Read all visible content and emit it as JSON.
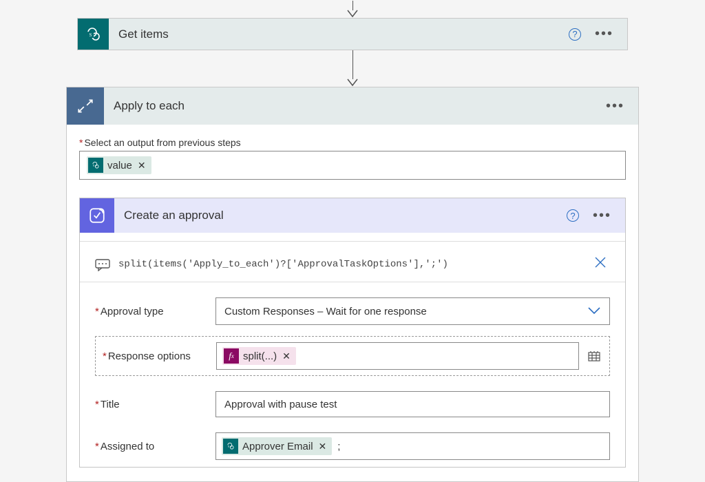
{
  "getItems": {
    "title": "Get items"
  },
  "applyEach": {
    "title": "Apply to each",
    "selectOutputLabel": "Select an output from previous steps",
    "token": {
      "label": "value"
    }
  },
  "approval": {
    "title": "Create an approval",
    "expression": "split(items('Apply_to_each')?['ApprovalTaskOptions'],';')",
    "fields": {
      "approvalType": {
        "label": "Approval type",
        "value": "Custom Responses – Wait for one response"
      },
      "responseOptions": {
        "label": "Response options",
        "token": "split(...)"
      },
      "title": {
        "label": "Title",
        "value": "Approval with pause test"
      },
      "assignedTo": {
        "label": "Assigned to",
        "token": "Approver Email",
        "suffix": " ;"
      }
    }
  }
}
